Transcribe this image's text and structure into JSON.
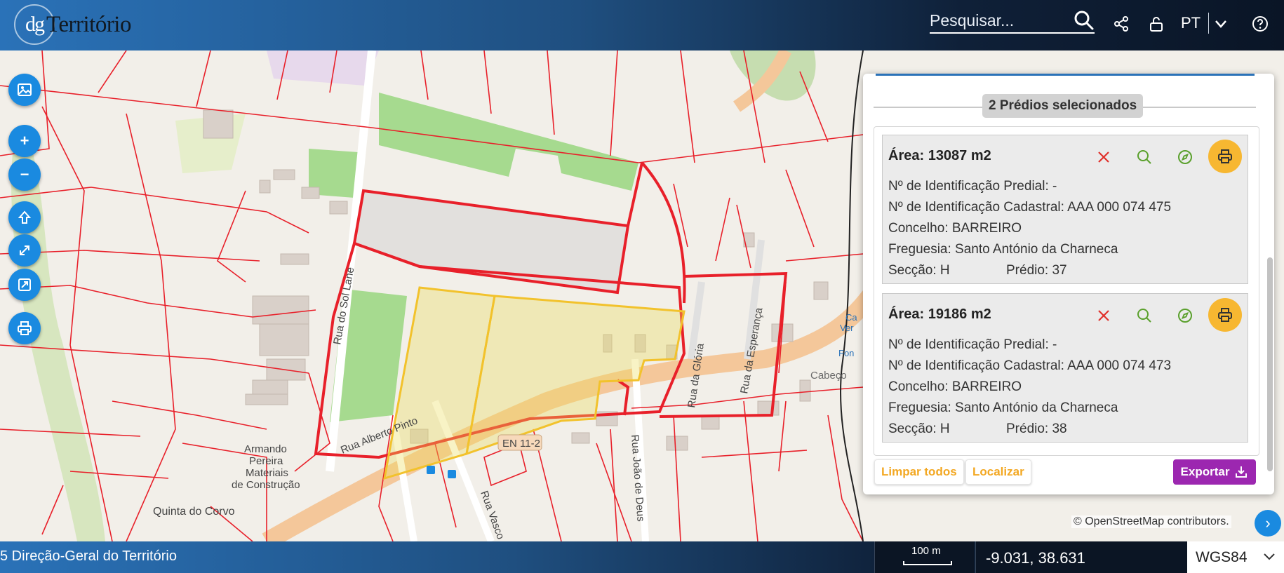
{
  "header": {
    "logo_mark": "dg",
    "logo_text": "Território",
    "search_placeholder": "Pesquisar...",
    "language": "PT"
  },
  "panel": {
    "selected_count_label": "2 Prédios selecionados",
    "cards": [
      {
        "area": "Área: 13087 m2",
        "predial_id": "Nº de Identificação Predial: -",
        "cadastral_id": "Nº de Identificação Cadastral: AAA 000 074 475",
        "concelho": "Concelho: BARREIRO",
        "freguesia": "Freguesia: Santo António da Charneca",
        "seccao": "Secção: H",
        "predio": "Prédio: 37"
      },
      {
        "area": "Área: 19186 m2",
        "predial_id": "Nº de Identificação Predial: -",
        "cadastral_id": "Nº de Identificação Cadastral: AAA 000 074 473",
        "concelho": "Concelho: BARREIRO",
        "freguesia": "Freguesia: Santo António da Charneca",
        "seccao": "Secção: H",
        "predio": "Prédio: 38"
      }
    ],
    "clear_all_label": "Limpar todos",
    "locate_label": "Localizar",
    "export_label": "Exportar"
  },
  "map": {
    "labels": {
      "rua_alberto_pinto": "Rua Alberto Pinto",
      "en_11_2": "EN 11-2",
      "rua_joao_de_deus": "Rua João de Deus",
      "rua_da_gloria": "Rua da Glória",
      "rua_da_esperanca": "Rua da Esperança",
      "rua_vasco": "Rua Vasco",
      "rua_sol": "Rua do Sol Lane",
      "armando_1": "Armando",
      "armando_2": "Pereira",
      "armando_3": "Materiais",
      "armando_4": "de Construção",
      "quinta": "Quinta do Corvo",
      "cabeco": "Cabeço",
      "ca": "Ca",
      "ver": "Ver",
      "fon": "Fon"
    },
    "attribution": "© OpenStreetMap contributors."
  },
  "footer": {
    "copyright": "5 Direção-Geral do Território",
    "scale_label": "100 m",
    "coordinates": "-9.031, 38.631",
    "crs": "WGS84"
  },
  "colors": {
    "accent": "#1a8ae0",
    "parcel_line": "#e8202a",
    "selected_outline": "#f2c22c",
    "print_button": "#f7b731",
    "export_button": "#9c27b0",
    "link_text": "#f3a823"
  }
}
